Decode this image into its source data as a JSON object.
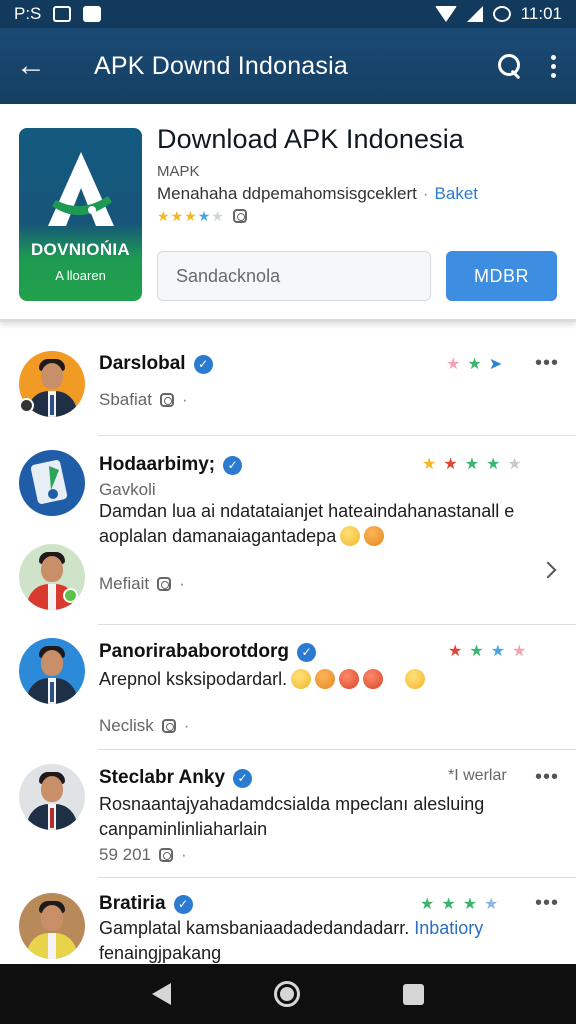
{
  "status_bar": {
    "left_text": "P:S",
    "time": "11:01",
    "icons": [
      "image-icon",
      "app-icon",
      "wifi-icon",
      "signal-icon",
      "data-icon"
    ]
  },
  "app_bar": {
    "title": "APK Downd Indonasia",
    "icons": [
      "back-arrow-icon",
      "search-icon",
      "more-vert-icon"
    ]
  },
  "app_card": {
    "logo_text": "DOVNIOŃIA",
    "logo_sub": "A lloaren",
    "title": "Download APK Indonesia",
    "subtitle": "MAPK",
    "description": "Menahaha ddpemahomsisgceklert",
    "dot": "·",
    "link": "Baket",
    "rating_filled": 4,
    "rating_total": 5,
    "input_value": "Sandacknola",
    "button_label": "MDBR"
  },
  "feed": {
    "posts": [
      {
        "name": "Darslobal",
        "verified": true,
        "meta": "Sbafiat",
        "body_lines": [],
        "stars": [
          "#f4a3b3",
          "#3bb56e",
          "#2b87d6"
        ],
        "avatar_bg": "#f19a24"
      },
      {
        "name": "Hodaarbimy;",
        "verified": true,
        "meta": "Gavkoli",
        "body_lines": [
          "Damdan lua ai ndatataianjet hateaindahanastanall e",
          "aoplalan damanaiagantadepa"
        ],
        "stars": [
          "#f3b72a",
          "#e2463b",
          "#3bb56e",
          "#3bb56e",
          "#c9c9c9"
        ],
        "avatar_bg": "#1f5da8"
      },
      {
        "name": "",
        "verified": false,
        "meta": "Mefiait",
        "body_lines": [],
        "stars": [],
        "avatar_bg": "#cfe3c8"
      },
      {
        "name": "Panorirababorotdorg",
        "verified": true,
        "meta": "Neclisk",
        "body_lines": [
          "Arepnol ksksipodardarl."
        ],
        "stars": [
          "#e2463b",
          "#3bb56e",
          "#4aa7de",
          "#f4a3b3"
        ],
        "avatar_bg": "#2c8ad8"
      },
      {
        "name": "Steclabr Anky",
        "verified": true,
        "meta": "59 201",
        "body_lines": [
          "Rosnaantajyahadamdcsialda mpeclanı alesluing",
          "canpaminlinliaharlain"
        ],
        "stars": [],
        "rating_text": "*I werlar",
        "avatar_bg": "#dfe3e6"
      },
      {
        "name": "Bratiria",
        "verified": true,
        "meta": "",
        "body_lines": [
          "Gamplatal kamsbaniaadadedandadarr.",
          "fenaingjpakang"
        ],
        "body_link": "Inbatiory",
        "stars": [
          "#3bb56e",
          "#3bb56e",
          "#3bb56e",
          "#8fb4e6"
        ],
        "avatar_bg": "#b88a5a"
      }
    ]
  },
  "nav_bar": {
    "icons": [
      "nav-back-icon",
      "nav-home-icon",
      "nav-recents-icon"
    ]
  }
}
